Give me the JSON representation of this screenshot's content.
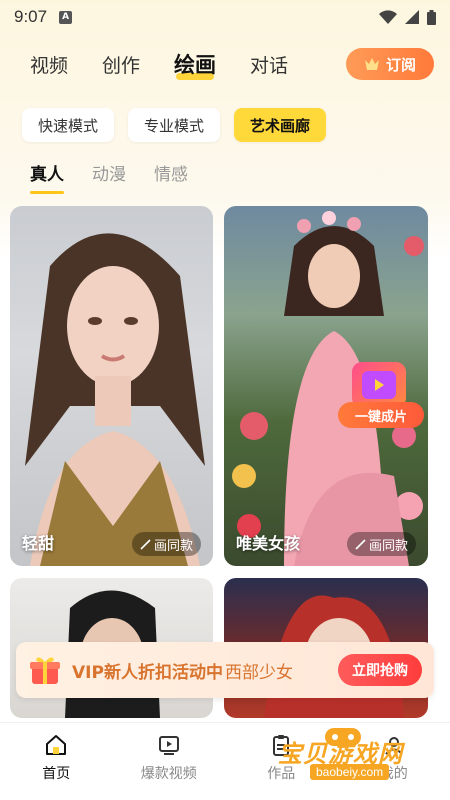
{
  "status_bar": {
    "time": "9:07",
    "notif_letter": "A"
  },
  "top_nav": {
    "tabs": [
      {
        "label": "视频",
        "active": false
      },
      {
        "label": "创作",
        "active": false
      },
      {
        "label": "绘画",
        "active": true
      },
      {
        "label": "对话",
        "active": false
      }
    ],
    "subscribe_label": "订阅"
  },
  "modes": [
    {
      "label": "快速模式",
      "active": false
    },
    {
      "label": "专业模式",
      "active": false
    },
    {
      "label": "艺术画廊",
      "active": true
    }
  ],
  "sub_tabs": [
    {
      "label": "真人",
      "active": true
    },
    {
      "label": "动漫",
      "active": false
    },
    {
      "label": "情感",
      "active": false
    }
  ],
  "cards": [
    {
      "title": "轻甜",
      "action_label": "画同款"
    },
    {
      "title": "唯美女孩",
      "action_label": "画同款"
    }
  ],
  "quick_badge_label": "一键成片",
  "promo": {
    "text": "VIP新人折扣活动中",
    "overlap_text": "西部少女",
    "button_label": "立即抢购"
  },
  "bottom_nav": [
    {
      "label": "首页",
      "icon": "home-icon",
      "active": true
    },
    {
      "label": "爆款视频",
      "icon": "video-icon",
      "active": false
    },
    {
      "label": "作品",
      "icon": "works-icon",
      "active": false
    },
    {
      "label": "我的",
      "icon": "profile-icon",
      "active": false
    }
  ],
  "watermark": {
    "text": "宝贝游戏网",
    "url": "baobeiy.com"
  },
  "colors": {
    "accent": "#ffd43b",
    "orange": "#ff7a3a",
    "promo_text": "#d9742f"
  }
}
